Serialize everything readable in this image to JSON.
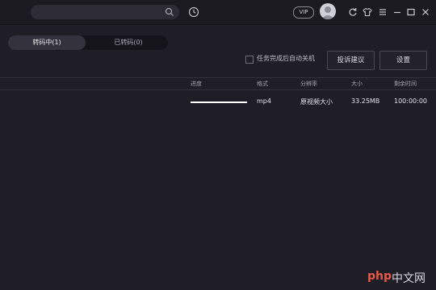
{
  "toolbar": {
    "search_placeholder": "",
    "vip_label": "VIP"
  },
  "tabs": [
    {
      "label": "转码中(1)",
      "active": true
    },
    {
      "label": "已转码(0)",
      "active": false
    }
  ],
  "options": {
    "shutdown_label": "任务完成后自动关机",
    "shutdown_checked": false,
    "feedback_label": "投诉建议",
    "settings_label": "设置"
  },
  "table": {
    "headers": [
      "进度",
      "格式",
      "分辨率",
      "大小",
      "剩余时间"
    ],
    "rows": [
      {
        "progress": 1.0,
        "format": "mp4",
        "resolution": "原视频大小",
        "size": "33.25MB",
        "remaining": "100:00:00"
      }
    ]
  },
  "watermark": {
    "brand": "php",
    "site": "中文网"
  },
  "colors": {
    "accent": "#ffffff",
    "background": "#1f1d26",
    "watermark_red": "#e35a4a"
  }
}
